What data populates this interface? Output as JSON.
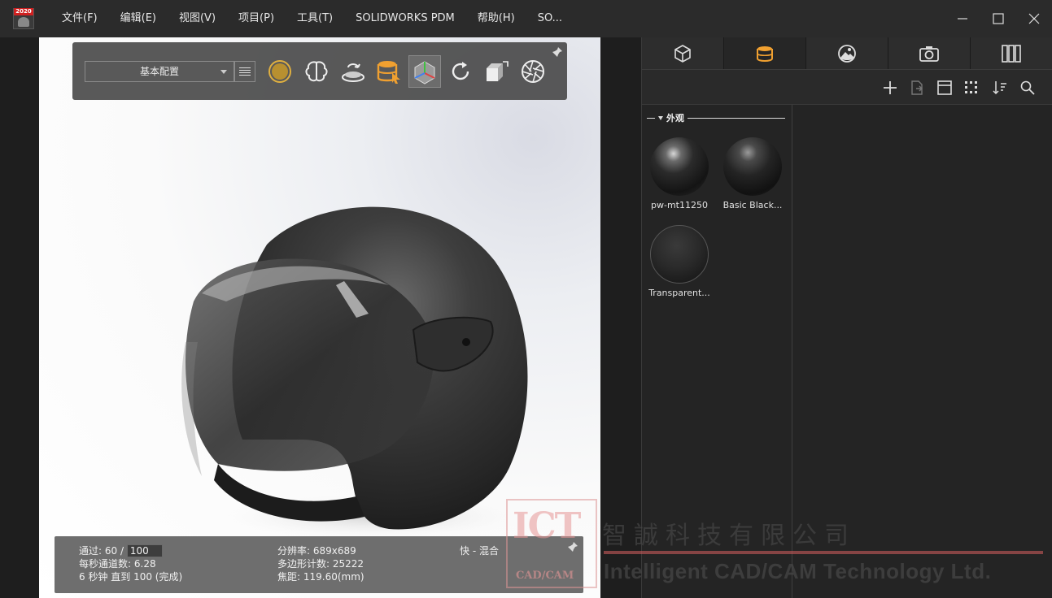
{
  "app": {
    "icon_year": "2020",
    "menu": [
      "文件(F)",
      "编辑(E)",
      "视图(V)",
      "项目(P)",
      "工具(T)",
      "SOLIDWORKS PDM",
      "帮助(H)",
      "SO..."
    ]
  },
  "toolbar": {
    "config_value": "基本配置",
    "tools": [
      {
        "icon": "render-sphere-icon",
        "active": false
      },
      {
        "icon": "brain-icon",
        "active": false
      },
      {
        "icon": "turntable-icon",
        "active": false
      },
      {
        "icon": "material-drop-icon",
        "active": false
      },
      {
        "icon": "scene-gizmo-icon",
        "active": true
      },
      {
        "icon": "refresh-icon",
        "active": false
      },
      {
        "icon": "cube-resize-icon",
        "active": false
      },
      {
        "icon": "aperture-icon",
        "active": false
      }
    ]
  },
  "status": {
    "passes_label": "通过:",
    "passes_current": "60 /",
    "passes_max": "100",
    "pps_label": "每秒通道数:",
    "pps_value": "6.28",
    "time_line": "6 秒钟 直到 100 (完成)",
    "resolution": "分辨率: 689x689",
    "polycount": "多边形计数: 25222",
    "focal": "焦距: 119.60(mm)",
    "mode": "快 - 混合"
  },
  "panel": {
    "tabs": [
      {
        "icon": "model-cube-icon",
        "active": false
      },
      {
        "icon": "materials-drum-icon",
        "active": true
      },
      {
        "icon": "environment-icon",
        "active": false
      },
      {
        "icon": "camera-icon",
        "active": false
      },
      {
        "icon": "textures-icon",
        "active": false
      }
    ],
    "section_title": "外观",
    "materials": [
      {
        "name": "pw-mt11250",
        "style": "black1"
      },
      {
        "name": "Basic Black...",
        "style": "black2"
      },
      {
        "name": "Transparent...",
        "style": "trans"
      }
    ]
  },
  "watermark": {
    "logo_big": "ICT",
    "logo_small": "CAD/CAM",
    "company_cn": "智誠科技有限公司",
    "company_en": "Intelligent CAD/CAM Technology Ltd."
  },
  "colors": {
    "accent_orange": "#f0a030",
    "panel_bg": "#242424",
    "titlebar_bg": "#2b2b2b"
  }
}
